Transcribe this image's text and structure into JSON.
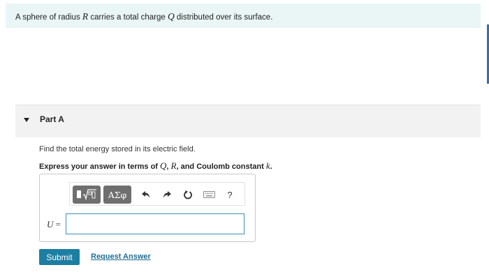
{
  "intro": {
    "text_before_r": "A sphere of radius ",
    "var_r": "R",
    "text_before_q": " carries a total charge ",
    "var_q": "Q",
    "text_after": " distributed over its surface."
  },
  "part": {
    "title": "Part A",
    "question": "Find the total energy stored in its electric field.",
    "instruction_prefix": "Express your answer in terms of ",
    "var_q": "Q",
    "sep1": ", ",
    "var_r": "R",
    "instruction_mid": ", and Coulomb constant ",
    "var_k": "k",
    "instruction_end": "."
  },
  "toolbar": {
    "greek_label": "ΑΣφ",
    "help_label": "?"
  },
  "answer": {
    "var_label": "U",
    "equals": " =",
    "value": "",
    "placeholder": ""
  },
  "actions": {
    "submit_label": "Submit",
    "request_label": "Request Answer"
  },
  "colors": {
    "intro_bg": "#eaf6f6",
    "submit_bg": "#1c7fa2",
    "link": "#1f6d93",
    "input_border": "#3d8fb8",
    "toolbar_btn": "#6f6f6f"
  },
  "icons": [
    "matrix-sqrt-template-icon",
    "undo-icon",
    "redo-icon",
    "reset-icon",
    "keyboard-icon",
    "help-icon",
    "collapse-caret-icon"
  ]
}
